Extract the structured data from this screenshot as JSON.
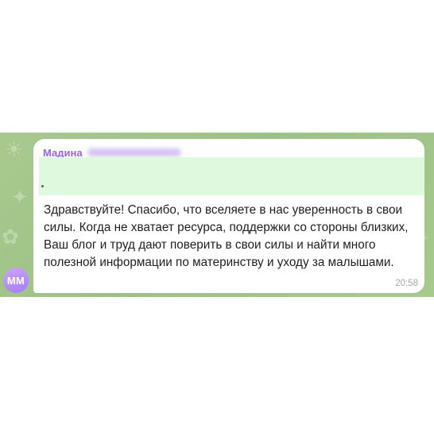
{
  "sender": {
    "initials": "ММ",
    "first_name": "Мадина"
  },
  "message": {
    "text": "Здравствуйте! Спасибо, что вселяете в нас уверенность в свои силы. Когда не хватает ресурса, поддержки со стороны близких, Ваш блог и труд дают поверить в свои силы и найти много полезной информации по материнству и уходу за малышами.",
    "time": "20:58"
  },
  "colors": {
    "background_pattern": "#9cc186",
    "bubble": "#ffffff",
    "sender_name": "#9a62e8",
    "quote_highlight": "#def9dd",
    "avatar": "#b58ff4",
    "timestamp": "#a0a7ad"
  },
  "icons": [
    "sun-doodle-icon",
    "star-doodle-icon",
    "rocket-doodle-icon",
    "flower-doodle-icon"
  ]
}
